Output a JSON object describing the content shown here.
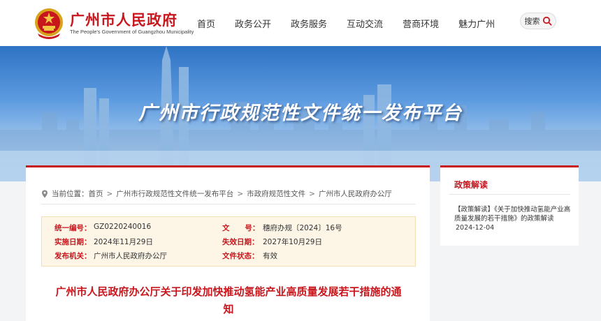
{
  "header": {
    "site_title": "广州市人民政府",
    "site_subtitle": "The People's Government of Guangzhou Municipality",
    "nav": [
      {
        "label": "首页"
      },
      {
        "label": "政务公开"
      },
      {
        "label": "政务服务"
      },
      {
        "label": "互动交流"
      },
      {
        "label": "营商环境"
      },
      {
        "label": "魅力广州"
      }
    ],
    "search_label": "搜索"
  },
  "banner": {
    "title": "广州市行政规范性文件统一发布平台"
  },
  "breadcrumb": {
    "prefix": "当前位置：",
    "items": [
      "首页",
      "广州市行政规范性文件统一发布平台",
      "市政府规范性文件",
      "广州市人民政府办公厅"
    ],
    "separator": ">"
  },
  "doc_info": {
    "serial_label": "统一编号：",
    "serial_value": "GZ0220240016",
    "number_label": "文      号：",
    "number_value": "穗府办规〔2024〕16号",
    "effective_label": "实施日期：",
    "effective_value": "2024年11月29日",
    "expiry_label": "失效日期：",
    "expiry_value": "2027年10月29日",
    "issuer_label": "发布机关：",
    "issuer_value": "广州市人民政府办公厅",
    "status_label": "文件状态：",
    "status_value": "有效"
  },
  "document": {
    "title": "广州市人民政府办公厅关于印发加快推动氢能产业高质量发展若干措施的通知"
  },
  "sidebar": {
    "title": "政策解读",
    "item_text": "【政策解读】《关于加快推动氢能产业高质量发展的若干措施》的政策解读",
    "item_date": "2024-12-04"
  },
  "colors": {
    "brand_red": "#c8161d",
    "info_bg": "#fdf6e7"
  }
}
